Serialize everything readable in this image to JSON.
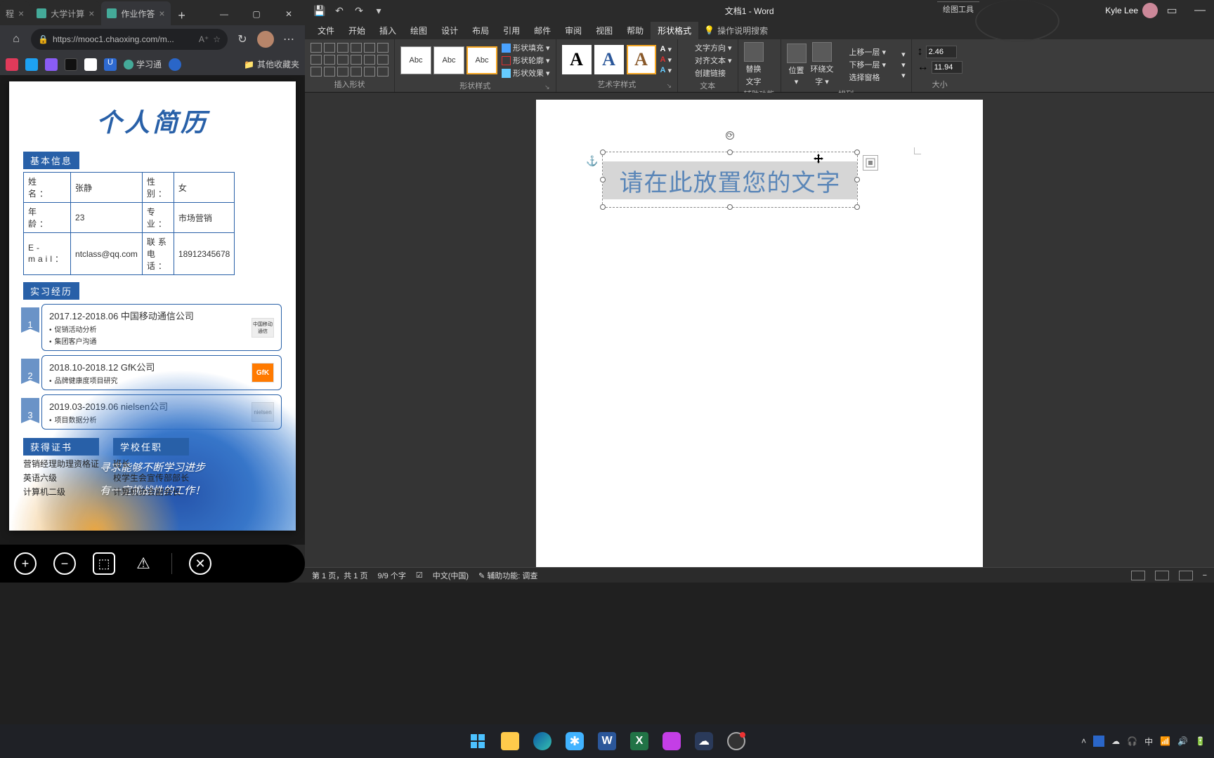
{
  "browser": {
    "tabs": [
      {
        "label": "程",
        "active": false
      },
      {
        "label": "大学计算",
        "active": false
      },
      {
        "label": "作业作答",
        "active": true
      }
    ],
    "address": "https://mooc1.chaoxing.com/m...",
    "bookmarks": {
      "xuexitong": "学习通",
      "other_favorites": "其他收藏夹"
    },
    "resume": {
      "title": "个人简历",
      "sections": {
        "basic_info": "基本信息",
        "internship": "实习经历",
        "certificates": "获得证书",
        "school_roles": "学校任职"
      },
      "info": {
        "name_lbl": "姓    名：",
        "name": "张静",
        "gender_lbl": "性    别：",
        "gender": "女",
        "age_lbl": "年    龄：",
        "age": "23",
        "major_lbl": "专    业：",
        "major": "市场营销",
        "email_lbl": "E-mail：",
        "email": "ntclass@qq.com",
        "phone_lbl": "联系电话：",
        "phone": "18912345678"
      },
      "interns": [
        {
          "num": "1",
          "period": "2017.12-2018.06 中国移动通信公司",
          "b1": "促销活动分析",
          "b2": "集团客户沟通",
          "logo": "中国移动通信"
        },
        {
          "num": "2",
          "period": "2018.10-2018.12 GfK公司",
          "b1": "品牌健康度项目研究",
          "logo": "GfK"
        },
        {
          "num": "3",
          "period": "2019.03-2019.06  nielsen公司",
          "b1": "项目数据分析",
          "logo": "nielsen"
        }
      ],
      "certs": [
        "营销经理助理资格证",
        "英语六级",
        "计算机二级"
      ],
      "roles": [
        "班长",
        "校学生会宣传部部长",
        "计算机协会副会长"
      ],
      "motto1": "寻求能够不断学习进步",
      "motto2": "有一定挑战性的工作！"
    }
  },
  "word": {
    "qat": {
      "save": "保存",
      "undo": "撤销",
      "redo": "重做"
    },
    "doc_title": "文档1 - Word",
    "tool_context": "绘图工具",
    "user": "Kyle Lee",
    "tabs": [
      "文件",
      "开始",
      "插入",
      "绘图",
      "设计",
      "布局",
      "引用",
      "邮件",
      "审阅",
      "视图",
      "帮助",
      "形状格式"
    ],
    "tell_me": "操作说明搜索",
    "groups": {
      "insert_shape": "插入形状",
      "shape_styles": "形状样式",
      "wordart_styles": "艺术字样式",
      "text": "文本",
      "accessibility": "辅助功能",
      "arrange": "排列",
      "size": "大小"
    },
    "ribbon": {
      "style_box": "Abc",
      "shape_fill": "形状填充",
      "shape_outline": "形状轮廓",
      "shape_effects": "形状效果",
      "wa_letter": "A",
      "text_direction": "文字方向",
      "align_text": "对齐文本",
      "create_link": "创建链接",
      "alt_text1": "替换",
      "alt_text2": "文字",
      "position": "位置",
      "wrap1": "环绕文",
      "wrap2": "字",
      "bring_forward": "上移一层",
      "send_backward": "下移一层",
      "selection_pane": "选择窗格",
      "height": "2.46",
      "width": "11.94"
    },
    "wordart_text": "请在此放置您的文字",
    "status": {
      "page": "第 1 页，共 1 页",
      "words": "9/9 个字",
      "lang": "中文(中国)",
      "accessibility": "辅助功能: 调查"
    }
  },
  "colors": {
    "icons": {
      "music": "#e03a5a",
      "twitter": "#1da1f2",
      "purple": "#8a5cf5",
      "bw": "#ffffff",
      "box": "#ffffff",
      "u": "#2e6ad1",
      "globe": "#4a9",
      "s": "#2a66c8",
      "folder": "#e8a23a",
      "start_tl": "#4cc2ff",
      "start_tr": "#4cc2ff",
      "start_bl": "#4cc2ff",
      "start_br": "#4cc2ff",
      "explorer": "#ffca4b",
      "edge": "#34c0b0",
      "star": "#41b3ff",
      "word": "#2b579a",
      "excel": "#217346",
      "onenote": "#c43ee6",
      "cloud": "#ffffff",
      "obs": "#333333"
    }
  }
}
